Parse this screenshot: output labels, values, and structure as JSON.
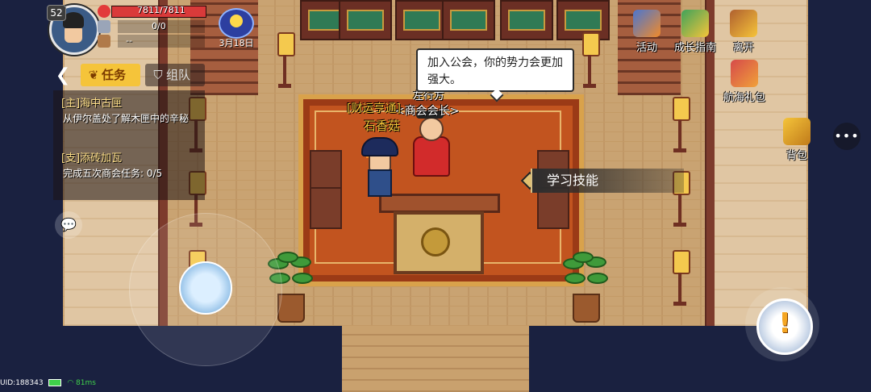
{
  "player": {
    "level": "52",
    "hp": "7811/7811",
    "hp_fraction": 1.0,
    "stat2": "0/0",
    "stat3": "--"
  },
  "calendar": {
    "date": "3月18日"
  },
  "top_buttons": [
    {
      "label": "活动",
      "icon": "activity-cards-icon"
    },
    {
      "label": "成长指南",
      "icon": "growth-guide-icon"
    },
    {
      "label": "离开",
      "icon": "exit-door-icon"
    }
  ],
  "side_buttons": [
    {
      "label": "航海礼包",
      "icon": "gift-box-icon"
    },
    {
      "label": "背包",
      "icon": "backpack-icon"
    }
  ],
  "tabs": {
    "task": "任务",
    "team": "组队"
  },
  "quests": [
    {
      "title": "[主]海中古匣",
      "desc": "从伊尔盖处了解木匣中的辛秘"
    },
    {
      "title": "[支]添砖加瓦",
      "desc": "完成五次商会任务: 0/5"
    }
  ],
  "dialog": {
    "bubble": "加入公会，你的势力会更加强大。"
  },
  "npc": {
    "title": "左行方",
    "name": "<商会会长>"
  },
  "hero": {
    "title": "[财运亨通]",
    "name": "石香菇"
  },
  "action": {
    "learn_skill": "学习技能"
  },
  "status": {
    "uid": "UID:188343",
    "ping": "81ms"
  },
  "colors": {
    "accent": "#f5c43a",
    "hp": "#d93a3a",
    "carpet": "#c2541f"
  }
}
